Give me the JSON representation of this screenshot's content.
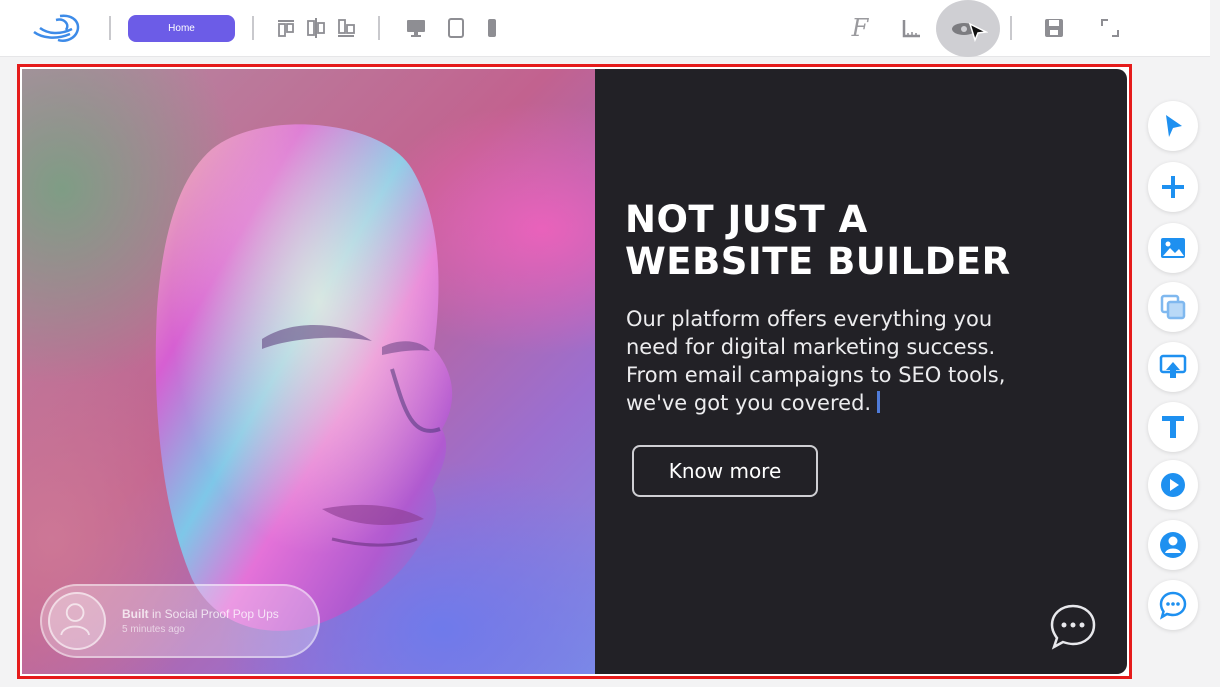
{
  "toolbar": {
    "home_label": "Home",
    "icons": [
      "logo-icon",
      "align-top-icon",
      "align-center-icon",
      "align-bottom-icon",
      "desktop-icon",
      "tablet-icon",
      "mobile-icon",
      "font-icon",
      "ruler-icon",
      "preview-eye-icon",
      "save-icon",
      "fullscreen-icon"
    ],
    "font_glyph": "F"
  },
  "hero": {
    "headline_line1": "NOT JUST A",
    "headline_line2": "WEBSITE BUILDER",
    "body_line1": "Our platform offers everything you",
    "body_line2": "need for digital marketing success.",
    "body_line3": "From email campaigns to SEO tools,",
    "body_line4": "we've got you covered.",
    "cta_label": "Know more"
  },
  "social_proof": {
    "title_bold": "Built",
    "title_rest": " in Social Proof Pop Ups",
    "time": "5 minutes ago"
  },
  "right_rail": {
    "tools": [
      "select-pointer-icon",
      "add-icon",
      "image-icon",
      "duplicate-icon",
      "upload-icon",
      "text-icon",
      "video-icon",
      "user-icon",
      "chat-icon"
    ]
  },
  "colors": {
    "accent": "#6c5ce7",
    "selection_border": "#e51b1b",
    "rail_icon": "#1e90f0",
    "dark_panel": "#222126"
  }
}
